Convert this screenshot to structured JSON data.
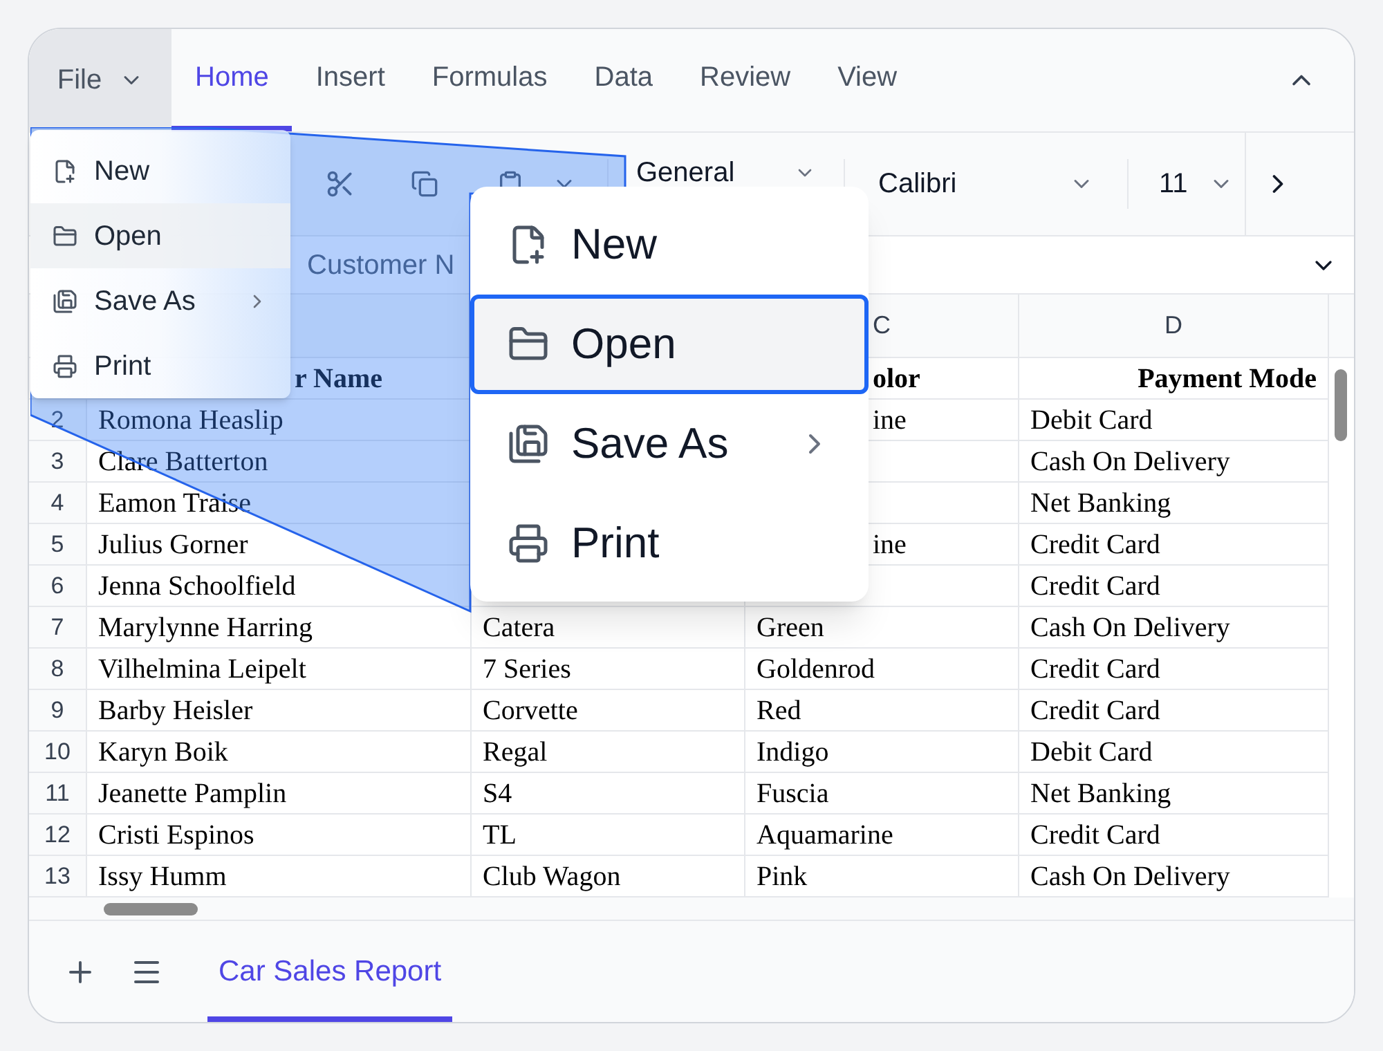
{
  "ribbon": {
    "file_button": {
      "label": "File",
      "open": true
    },
    "tabs": [
      {
        "label": "Home",
        "selected": true
      },
      {
        "label": "Insert",
        "selected": false
      },
      {
        "label": "Formulas",
        "selected": false
      },
      {
        "label": "Data",
        "selected": false
      },
      {
        "label": "Review",
        "selected": false
      },
      {
        "label": "View",
        "selected": false
      }
    ]
  },
  "toolbar": {
    "number_format": "General",
    "font": "Calibri",
    "font_size": "11"
  },
  "formula_bar": {
    "value": "Customer N"
  },
  "grid": {
    "header": {
      "column_c": "C",
      "column_d": "D"
    },
    "rows": [
      {
        "column_a": "r Name",
        "column_c": "olor",
        "column_d": "Payment Mode",
        "kind": "header"
      },
      {
        "number": "2",
        "column_a": "Romona Heaslip",
        "column_c": "ine",
        "column_d": "Debit Card"
      },
      {
        "number": "3",
        "column_a": "Clare Batterton",
        "column_d": "Cash On Delivery"
      },
      {
        "number": "4",
        "column_a": "Eamon Traise",
        "column_d": "Net Banking"
      },
      {
        "number": "5",
        "column_a": "Julius Gorner",
        "column_c": "ine",
        "column_d": "Credit Card"
      },
      {
        "number": "6",
        "column_a": "Jenna Schoolfield",
        "column_d": "Credit Card"
      },
      {
        "number": "7",
        "column_a": "Marylynne Harring",
        "column_b": "Catera",
        "column_c": "Green",
        "column_d": "Cash On Delivery"
      },
      {
        "number": "8",
        "column_a": "Vilhelmina Leipelt",
        "column_b": "7 Series",
        "column_c": "Goldenrod",
        "column_d": "Credit Card"
      },
      {
        "number": "9",
        "column_a": "Barby Heisler",
        "column_b": "Corvette",
        "column_c": "Red",
        "column_d": "Credit Card"
      },
      {
        "number": "10",
        "column_a": "Karyn Boik",
        "column_b": "Regal",
        "column_c": "Indigo",
        "column_d": "Debit Card"
      },
      {
        "number": "11",
        "column_a": "Jeanette Pamplin",
        "column_b": "S4",
        "column_c": "Fuscia",
        "column_d": "Net Banking"
      },
      {
        "number": "12",
        "column_a": "Cristi Espinos",
        "column_b": "TL",
        "column_c": "Aquamarine",
        "column_d": "Credit Card"
      },
      {
        "number": "13",
        "column_a": "Issy Humm",
        "column_b": "Club Wagon",
        "column_c": "Pink",
        "column_d": "Cash On Delivery"
      }
    ]
  },
  "file_menu": {
    "items": [
      {
        "label": "New",
        "kind": "new",
        "selected": false,
        "submenu": false
      },
      {
        "label": "Open",
        "kind": "open",
        "selected": true,
        "submenu": false
      },
      {
        "label": "Save As",
        "kind": "save",
        "selected": false,
        "submenu": true
      },
      {
        "label": "Print",
        "kind": "print",
        "selected": false,
        "submenu": false
      }
    ]
  },
  "magnified_menu": {
    "items": [
      {
        "label": "New",
        "kind": "new",
        "selected": false,
        "submenu": false
      },
      {
        "label": "Open",
        "kind": "open",
        "selected": true,
        "submenu": false
      },
      {
        "label": "Save As",
        "kind": "save",
        "selected": false,
        "submenu": true
      },
      {
        "label": "Print",
        "kind": "print",
        "selected": false,
        "submenu": false
      }
    ]
  },
  "sheet_tabs": [
    {
      "label": "Car Sales Report",
      "selected": true
    }
  ]
}
